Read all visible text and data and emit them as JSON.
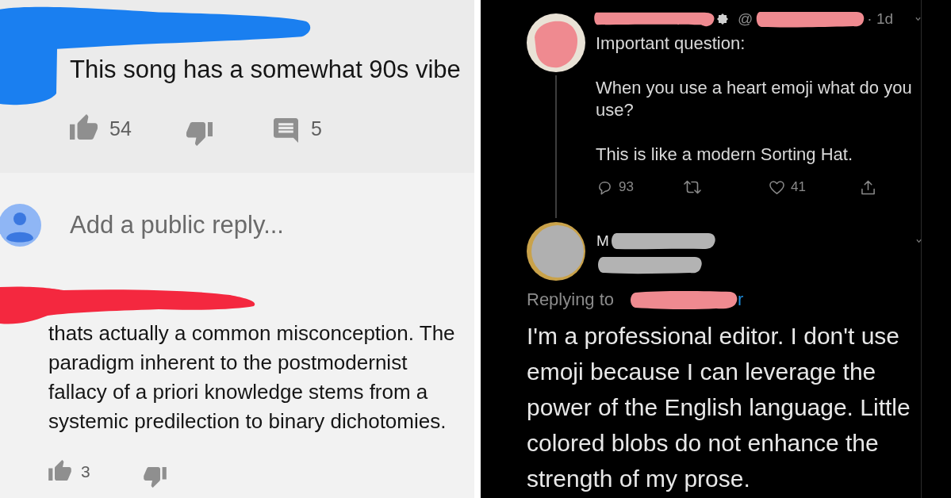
{
  "youtube_comments": {
    "comment": {
      "text": "This song has a somewhat 90s vibe",
      "like_count": "54",
      "reply_count": "5"
    },
    "reply_box": {
      "placeholder": "Add a public reply..."
    },
    "reply": {
      "text": "thats actually a common misconception. The paradigm inherent to the postmodernist fallacy of a priori knowledge stems from a systemic predilection to binary dichotomies.",
      "like_count": "3"
    }
  },
  "twitter_thread": {
    "tweet": {
      "handle_prefix": "@",
      "time": "· 1d",
      "paragraphs": [
        "Important question:",
        "When you use a heart emoji what do you use?",
        "This is like a modern Sorting Hat."
      ],
      "reply_count": "93",
      "like_count": "41"
    },
    "reply": {
      "name_visible": "M",
      "replying_label": "Replying to",
      "mention_visible": "r",
      "text": "I'm a professional editor. I don't use emoji because I can leverage the power of the English language. Little colored blobs do not enhance the strength of my prose."
    }
  }
}
